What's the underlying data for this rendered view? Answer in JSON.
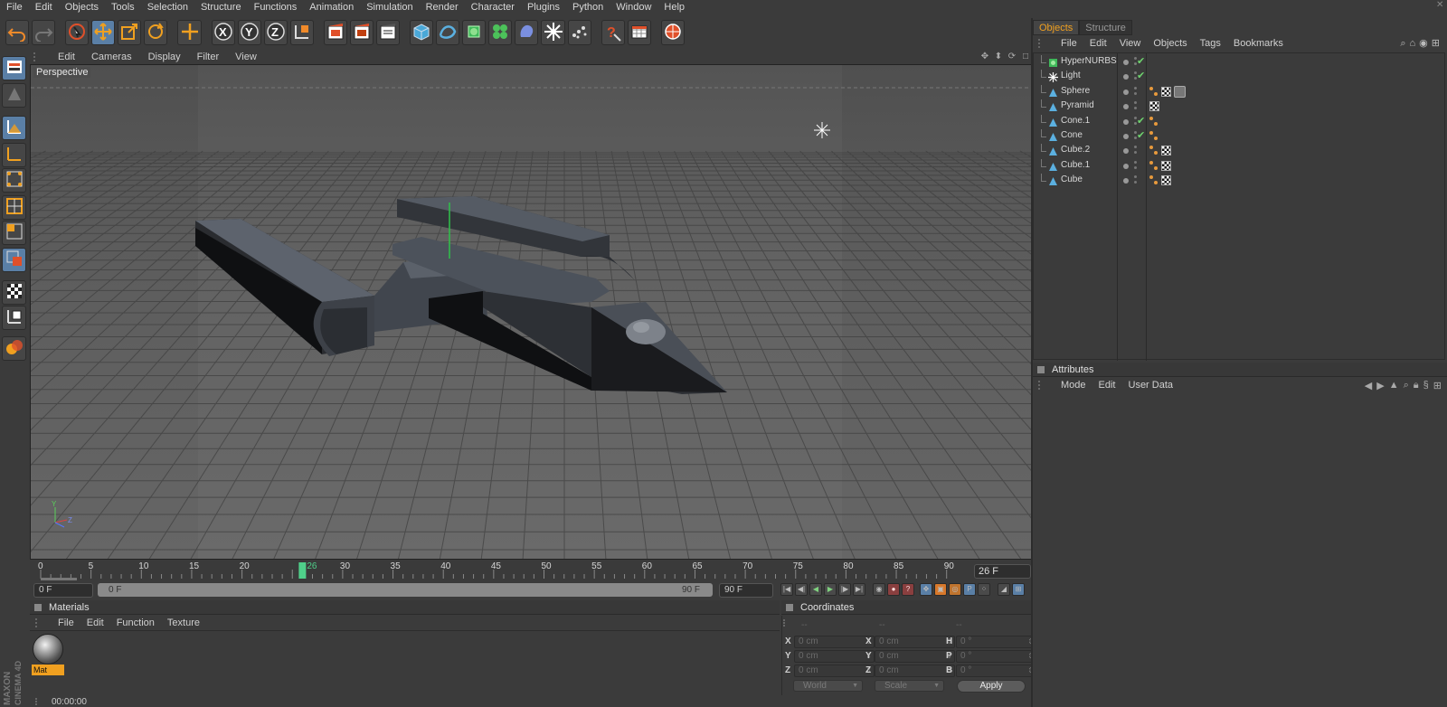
{
  "menubar": {
    "items": [
      "File",
      "Edit",
      "Objects",
      "Tools",
      "Selection",
      "Structure",
      "Functions",
      "Animation",
      "Simulation",
      "Render",
      "Character",
      "Plugins",
      "Python",
      "Window",
      "Help"
    ]
  },
  "toolbar": {
    "tools": [
      "undo-icon",
      "redo-icon",
      "live-selection-icon",
      "move-icon",
      "scale-icon",
      "rotate-icon",
      "add-object-icon",
      "x-axis-icon",
      "y-axis-icon",
      "z-axis-icon",
      "coordinate-system-icon",
      "render-view-icon",
      "render-picture-viewer-icon",
      "render-settings-icon",
      "cube-primitive-icon",
      "spline-icon",
      "subdivision-surface-icon",
      "cloner-icon",
      "deformer-icon",
      "scene-light-icon",
      "particle-icon",
      "help-icon",
      "timeline-icon",
      "sphere-render-icon"
    ]
  },
  "viewport": {
    "menu": [
      "Edit",
      "Cameras",
      "Display",
      "Filter",
      "View"
    ],
    "view_name": "Perspective",
    "axis_labels": {
      "y": "Y",
      "z": "Z"
    }
  },
  "timeline": {
    "ticks": [
      "0",
      "5",
      "10",
      "15",
      "20",
      "25",
      "30",
      "35",
      "40",
      "45",
      "50",
      "55",
      "60",
      "65",
      "70",
      "75",
      "80",
      "85",
      "90"
    ],
    "current_marker": "26",
    "current_frame": "26 F"
  },
  "playbar": {
    "start_field": "0 F",
    "range_start": "0 F",
    "range_end": "90 F",
    "end_field": "90 F"
  },
  "materials": {
    "title": "Materials",
    "menu": [
      "File",
      "Edit",
      "Function",
      "Texture"
    ],
    "items": [
      {
        "name": "Mat"
      }
    ]
  },
  "coordinates": {
    "title": "Coordinates",
    "dashes": [
      "--",
      "--",
      "--"
    ],
    "rows": [
      {
        "a": "X",
        "a_val": "0 cm",
        "b": "X",
        "b_val": "0 cm",
        "c": "H",
        "c_val": "0 °"
      },
      {
        "a": "Y",
        "a_val": "0 cm",
        "b": "Y",
        "b_val": "0 cm",
        "c": "P",
        "c_val": "0 °"
      },
      {
        "a": "Z",
        "a_val": "0 cm",
        "b": "Z",
        "b_val": "0 cm",
        "c": "B",
        "c_val": "0 °"
      }
    ],
    "mode": "World",
    "type": "Scale",
    "apply": "Apply"
  },
  "status": {
    "time": "00:00:00"
  },
  "brand": {
    "line1": "MAXON",
    "line2": "CINEMA 4D"
  },
  "object_manager": {
    "tabs": [
      "Objects",
      "Structure"
    ],
    "active_tab": "Objects",
    "menu": [
      "File",
      "Edit",
      "View",
      "Objects",
      "Tags",
      "Bookmarks"
    ],
    "objects": [
      {
        "name": "HyperNURBS",
        "icon": "hypernurbs",
        "check": "✔",
        "tags": []
      },
      {
        "name": "Light",
        "icon": "light",
        "check": "✔",
        "tags": []
      },
      {
        "name": "Sphere",
        "icon": "polygon",
        "check": "",
        "tags": [
          "phong",
          "texture",
          "compositing"
        ]
      },
      {
        "name": "Pyramid",
        "icon": "polygon",
        "check": "",
        "tags": [
          "texture"
        ]
      },
      {
        "name": "Cone.1",
        "icon": "polygon",
        "check": "✔",
        "tags": [
          "phong"
        ]
      },
      {
        "name": "Cone",
        "icon": "polygon",
        "check": "✔",
        "tags": [
          "phong"
        ]
      },
      {
        "name": "Cube.2",
        "icon": "polygon",
        "check": "",
        "tags": [
          "phong",
          "texture"
        ]
      },
      {
        "name": "Cube.1",
        "icon": "polygon",
        "check": "",
        "tags": [
          "phong",
          "texture"
        ]
      },
      {
        "name": "Cube",
        "icon": "polygon",
        "check": "",
        "tags": [
          "phong",
          "texture"
        ]
      }
    ]
  },
  "attributes": {
    "title": "Attributes",
    "menu": [
      "Mode",
      "Edit",
      "User Data"
    ]
  },
  "colors": {
    "accent": "#f0a020",
    "active_tool": "#5a7fa6",
    "check": "#6fd46f",
    "panel": "#3b3b3b"
  }
}
